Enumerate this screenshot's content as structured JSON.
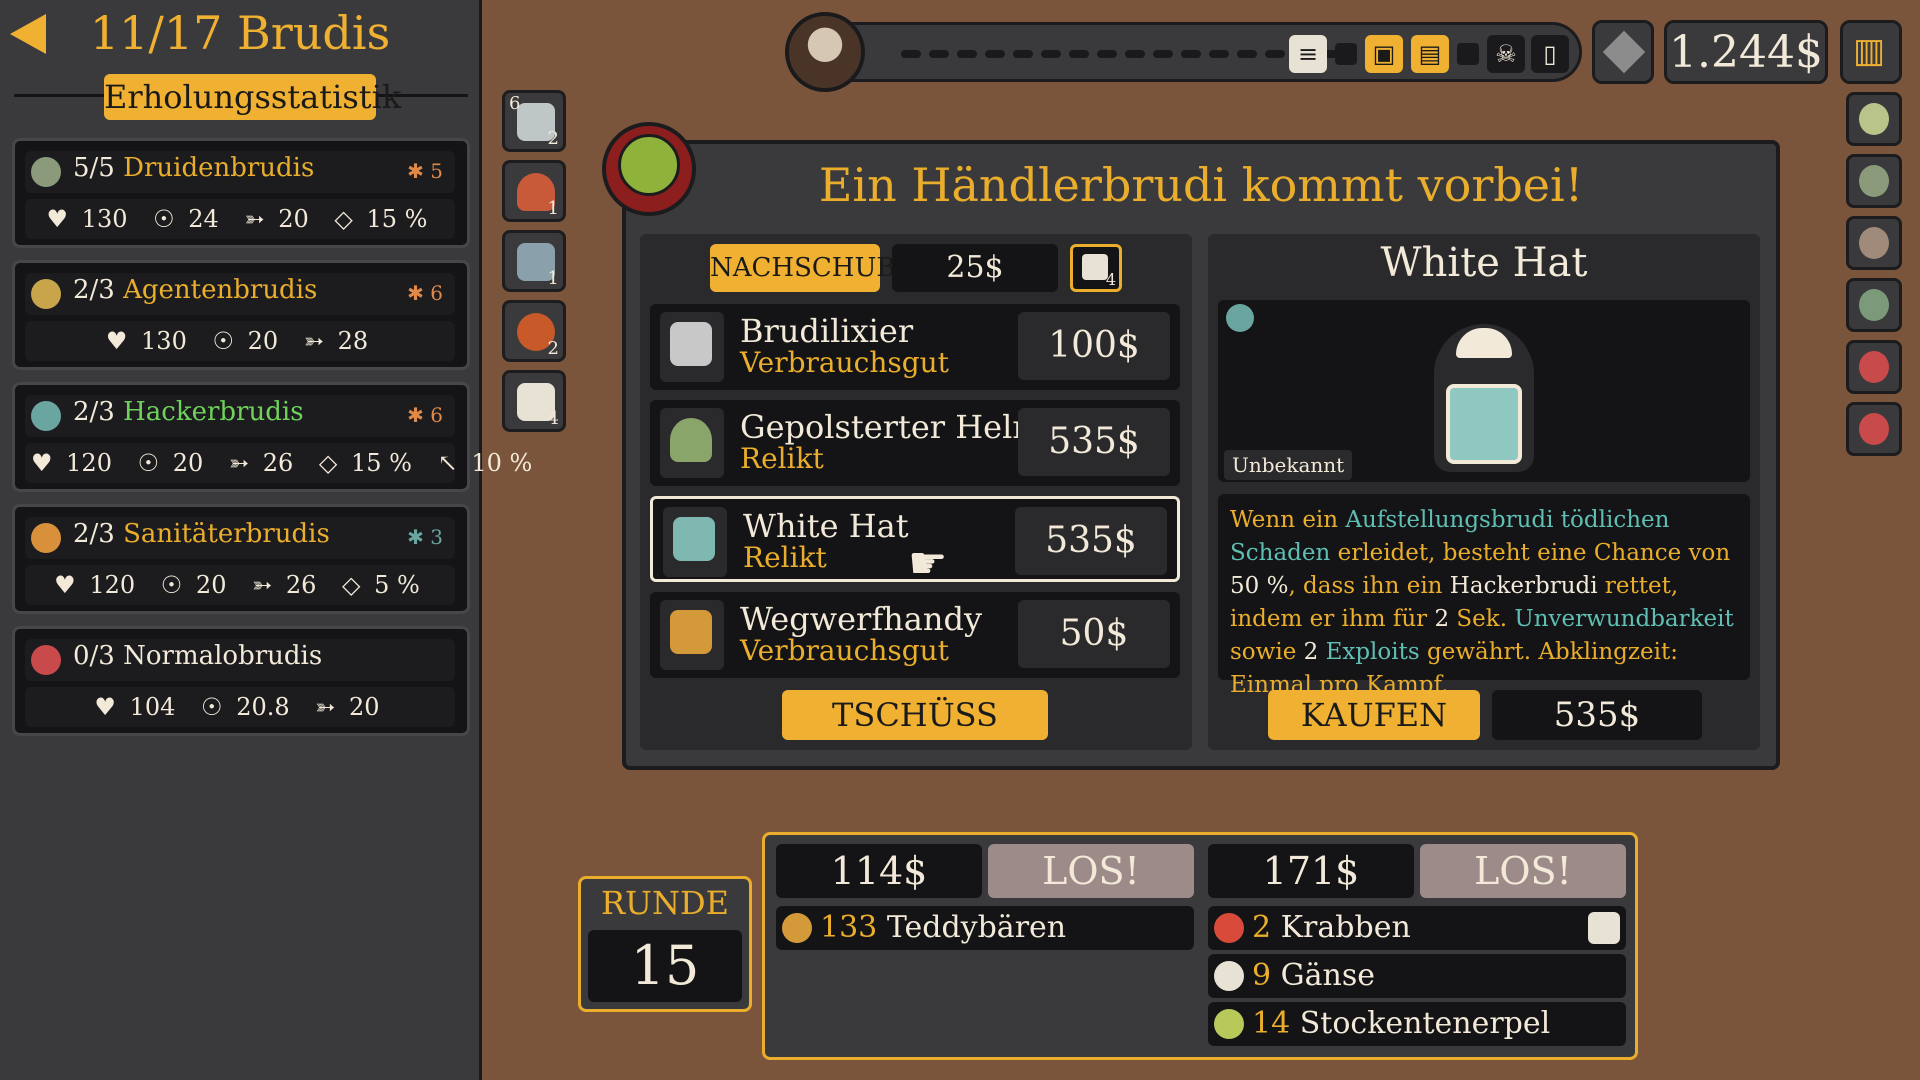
{
  "left_panel": {
    "brudi_count": "11/17 Brudis",
    "stats_tab": "Erholungsstatistik",
    "groups": [
      {
        "count": "5/5",
        "name": "Druidenbrudis",
        "name_color": "#eaae2c",
        "synergy": "5",
        "stats": [
          "130",
          "24",
          "20",
          "15 %"
        ]
      },
      {
        "count": "2/3",
        "name": "Agentenbrudis",
        "name_color": "#eaae2c",
        "synergy": "6",
        "stats": [
          "130",
          "20",
          "28"
        ]
      },
      {
        "count": "2/3",
        "name": "Hackerbrudis",
        "name_color": "#6fd35b",
        "synergy": "6",
        "stats": [
          "120",
          "20",
          "26",
          "15 %",
          "10 %"
        ]
      },
      {
        "count": "2/3",
        "name": "Sanitäterbrudis",
        "name_color": "#eaae2c",
        "synergy": "3",
        "stats": [
          "120",
          "20",
          "26",
          "5 %"
        ]
      },
      {
        "count": "0/3",
        "name": "Normalobrudis",
        "name_color": "#f2e9d8",
        "synergy": "",
        "stats": [
          "104",
          "20.8",
          "20"
        ]
      }
    ]
  },
  "item_strip": [
    {
      "icon": "syringe-icon",
      "count_top": "6",
      "count": "2"
    },
    {
      "icon": "mushroom-icon",
      "count_top": "",
      "count": "1"
    },
    {
      "icon": "xray-icon",
      "count_top": "",
      "count": "1"
    },
    {
      "icon": "fire-orb-icon",
      "count_top": "",
      "count": "2"
    },
    {
      "icon": "dice-icon",
      "count_top": "",
      "count": "4"
    }
  ],
  "top_bar": {
    "money": "1.244$",
    "icons": [
      "coins-icon",
      "cards-icon",
      "chest-icon",
      "skull-icon",
      "door-icon"
    ]
  },
  "dialog": {
    "title": "Ein Händlerbrudi kommt vorbei!",
    "restock_label": "NACHSCHUB",
    "restock_price": "25$",
    "restock_dice_count": "4",
    "items": [
      {
        "name": "Brudilixier",
        "type": "Verbrauchsgut",
        "price": "100$",
        "icon_color": "#c8c8c8"
      },
      {
        "name": "Gepolsterter Helm",
        "type": "Relikt",
        "price": "535$",
        "icon_color": "#8aa56a"
      },
      {
        "name": "White Hat",
        "type": "Relikt",
        "price": "535$",
        "icon_color": "#7fb8b0"
      },
      {
        "name": "Wegwerfhandy",
        "type": "Verbrauchsgut",
        "price": "50$",
        "icon_color": "#d49a3a"
      }
    ],
    "bye_label": "TSCHÜSS",
    "detail": {
      "title": "White Hat",
      "unknown_label": "Unbekannt",
      "desc_parts": [
        {
          "t": "Wenn ein ",
          "c": "gold"
        },
        {
          "t": "Aufstellungsbrudi",
          "c": "teal"
        },
        {
          "t": " ",
          "c": "gold"
        },
        {
          "t": "tödlichen Schaden",
          "c": "teal"
        },
        {
          "t": " erleidet, besteht eine Chance von ",
          "c": "gold"
        },
        {
          "t": "50 %",
          "c": "cream"
        },
        {
          "t": ", dass ihn ein ",
          "c": "gold"
        },
        {
          "t": "Hackerbrudi",
          "c": "cream"
        },
        {
          "t": " rettet, indem er ihm für ",
          "c": "gold"
        },
        {
          "t": "2",
          "c": "cream"
        },
        {
          "t": " Sek. ",
          "c": "gold"
        },
        {
          "t": "Unverwundbarkeit",
          "c": "teal"
        },
        {
          "t": " sowie ",
          "c": "gold"
        },
        {
          "t": "2",
          "c": "cream"
        },
        {
          "t": " ",
          "c": "gold"
        },
        {
          "t": "Exploits",
          "c": "teal"
        },
        {
          "t": " gewährt. Abklingzeit: Einmal pro Kampf.",
          "c": "gold"
        }
      ],
      "buy_label": "KAUFEN",
      "buy_price": "535$"
    }
  },
  "round": {
    "label": "RUNDE",
    "number": "15"
  },
  "encounters": [
    {
      "price": "114$",
      "go_label": "LOS!",
      "enemies": [
        {
          "count": "133",
          "name": "Teddybären",
          "icon_color": "#d49a3a"
        }
      ]
    },
    {
      "price": "171$",
      "go_label": "LOS!",
      "enemies": [
        {
          "count": "2",
          "name": "Krabben",
          "icon_color": "#d84a3a"
        },
        {
          "count": "9",
          "name": "Gänse",
          "icon_color": "#e8e2d4"
        },
        {
          "count": "14",
          "name": "Stockentenerpel",
          "icon_color": "#b8c95a"
        }
      ]
    }
  ]
}
